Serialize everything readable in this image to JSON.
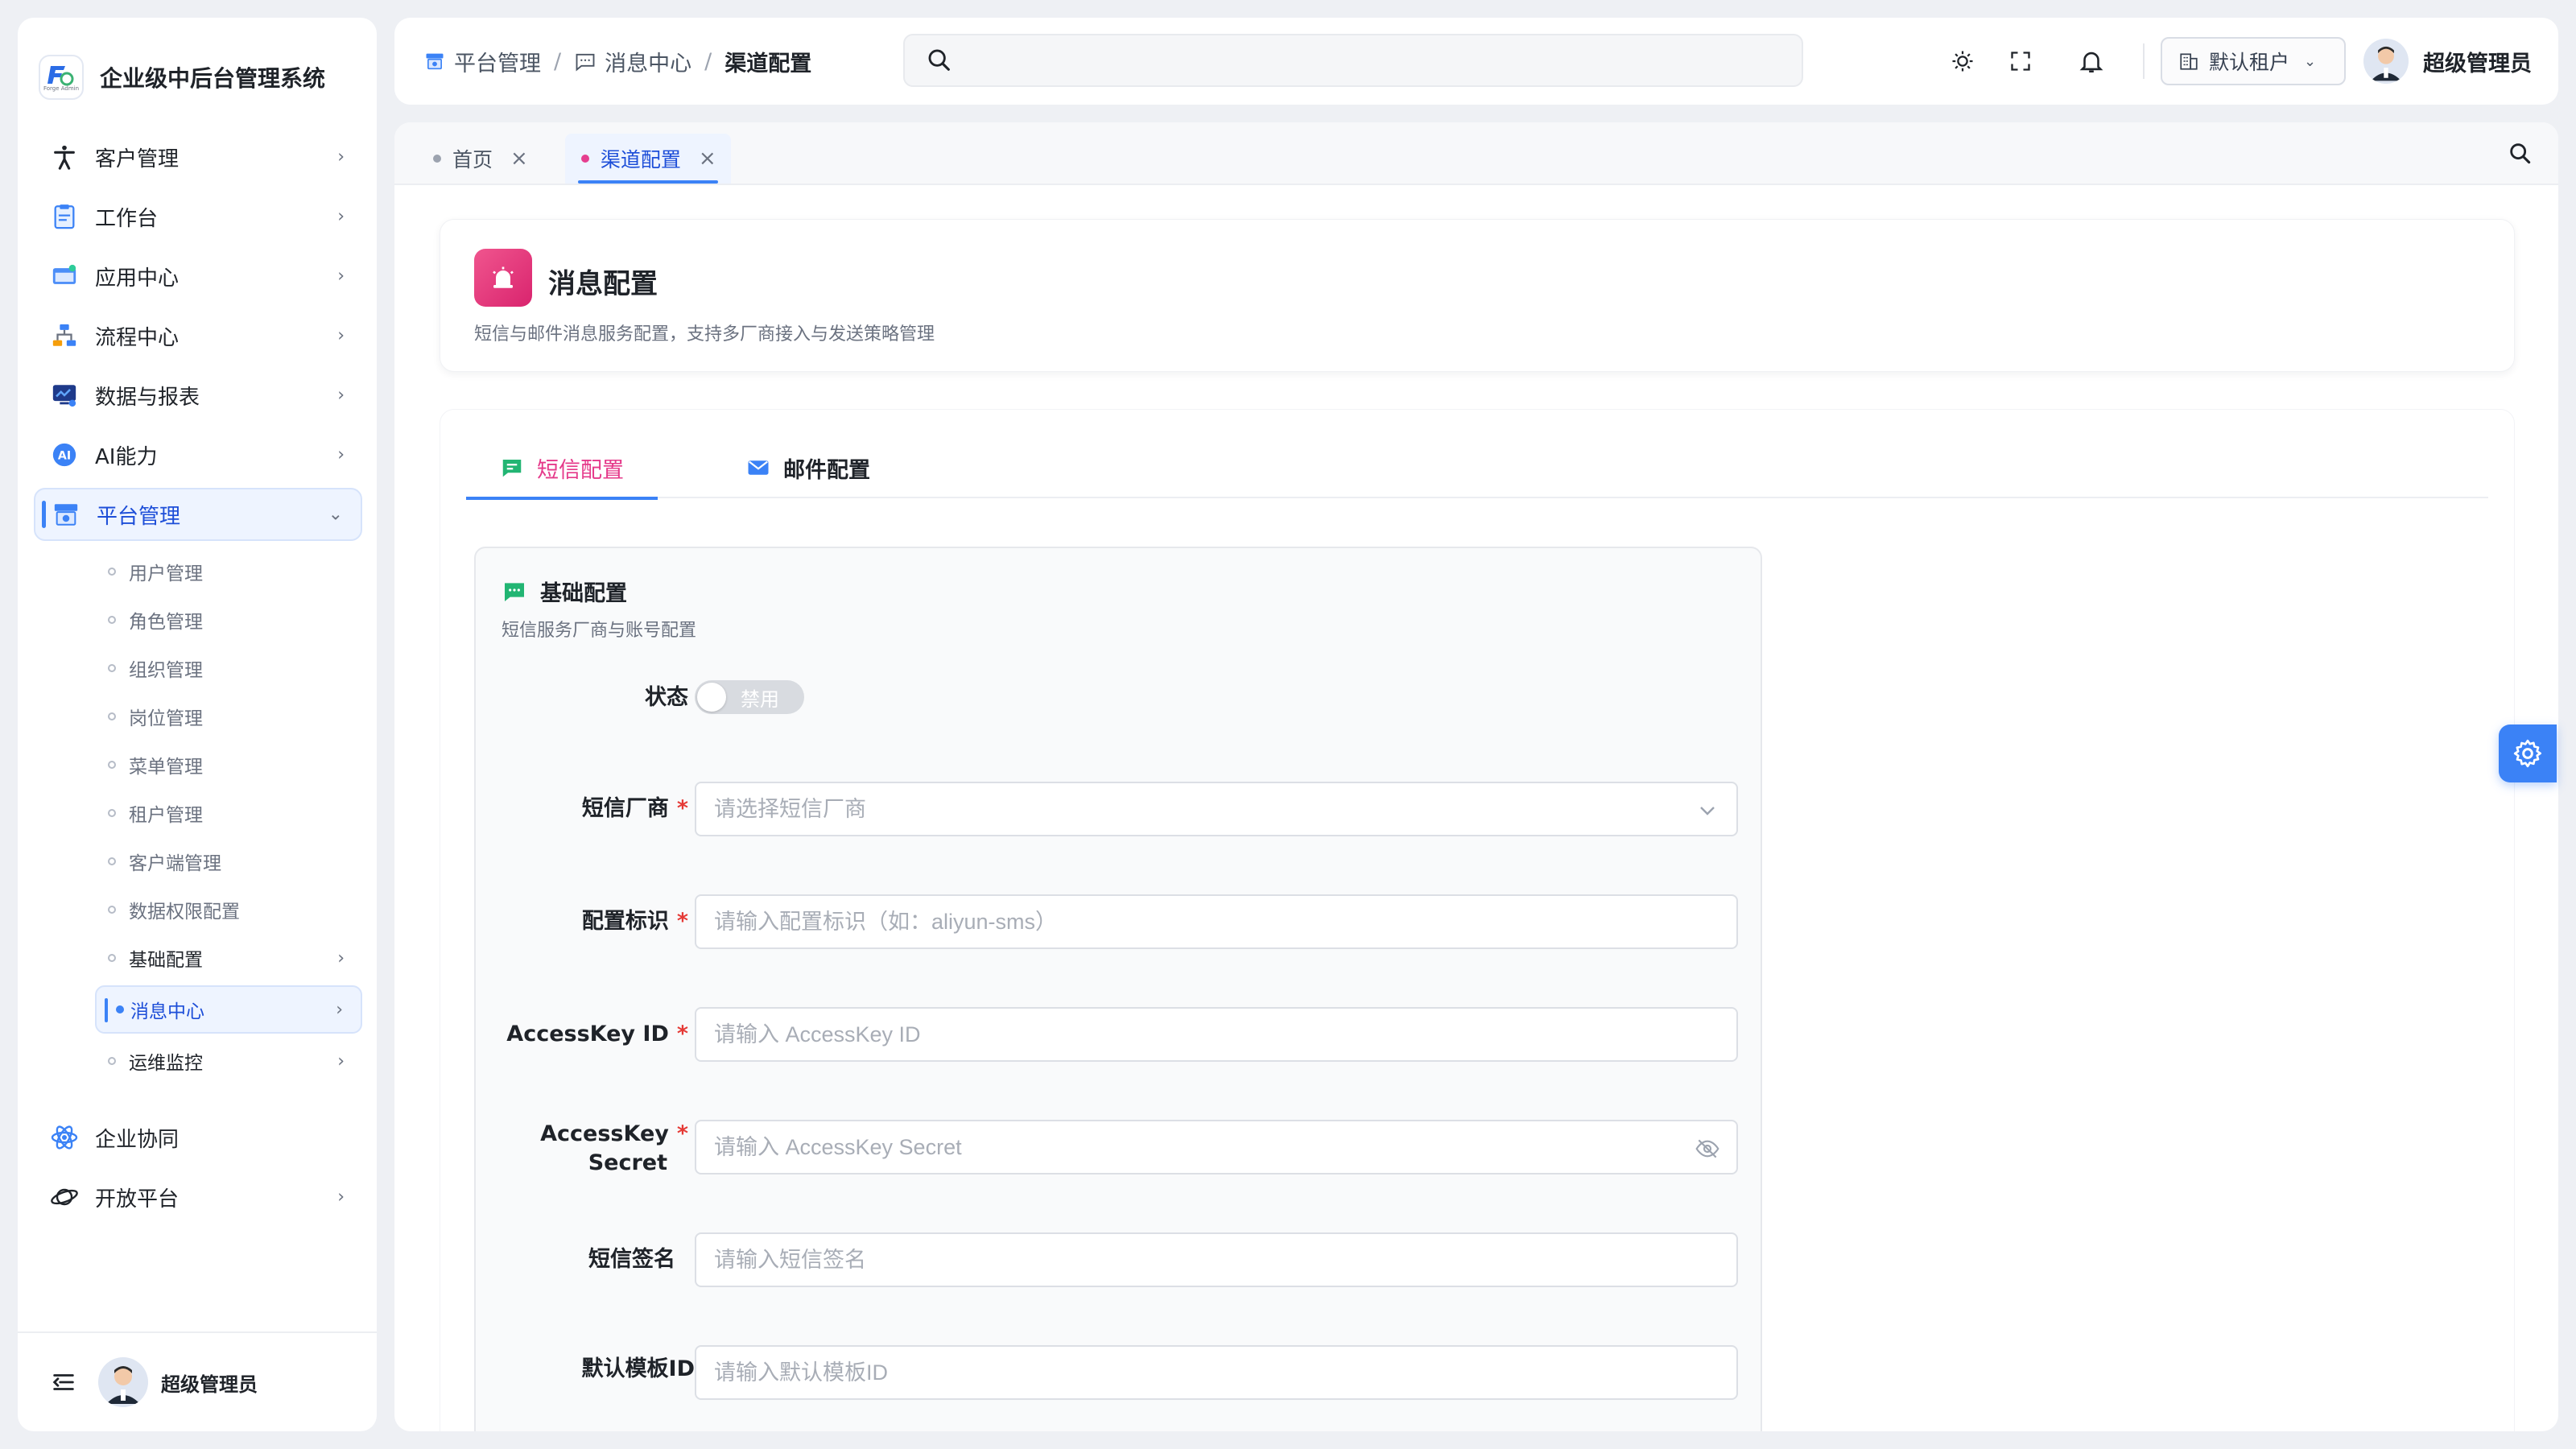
{
  "app": {
    "title": "企业级中后台管理系统",
    "logo_caption": "Forge Admin"
  },
  "sidebar": {
    "items": [
      {
        "label": "客户管理",
        "icon": "accessibility-icon"
      },
      {
        "label": "工作台",
        "icon": "clipboard-icon"
      },
      {
        "label": "应用中心",
        "icon": "app-window-icon"
      },
      {
        "label": "流程中心",
        "icon": "flow-icon"
      },
      {
        "label": "数据与报表",
        "icon": "monitor-chart-icon"
      },
      {
        "label": "AI能力",
        "icon": "ai-icon"
      },
      {
        "label": "平台管理",
        "icon": "platform-icon",
        "expanded": true
      }
    ],
    "platform_children": [
      {
        "label": "用户管理"
      },
      {
        "label": "角色管理"
      },
      {
        "label": "组织管理"
      },
      {
        "label": "岗位管理"
      },
      {
        "label": "菜单管理"
      },
      {
        "label": "租户管理"
      },
      {
        "label": "客户端管理"
      },
      {
        "label": "数据权限配置"
      },
      {
        "label": "基础配置"
      },
      {
        "label": "消息中心"
      },
      {
        "label": "运维监控"
      }
    ],
    "bottom_items": [
      {
        "label": "企业协同",
        "icon": "atom-icon"
      },
      {
        "label": "开放平台",
        "icon": "planet-icon"
      }
    ],
    "footer_user": "超级管理员"
  },
  "header": {
    "breadcrumb": [
      "平台管理",
      "消息中心",
      "渠道配置"
    ],
    "search_placeholder": "",
    "tenant": "默认租户",
    "user_name": "超级管理员"
  },
  "tabs": [
    {
      "label": "首页"
    },
    {
      "label": "渠道配置",
      "active": true
    }
  ],
  "page": {
    "title": "消息配置",
    "description": "短信与邮件消息服务配置，支持多厂商接入与发送策略管理"
  },
  "content_tabs": [
    {
      "label": "短信配置",
      "active": true
    },
    {
      "label": "邮件配置"
    }
  ],
  "form": {
    "section_title": "基础配置",
    "section_subtitle": "短信服务厂商与账号配置",
    "status_label": "状态",
    "status_value": "禁用",
    "vendor_label": "短信厂商",
    "vendor_placeholder": "请选择短信厂商",
    "config_key_label": "配置标识",
    "config_key_placeholder": "请输入配置标识（如：aliyun-sms）",
    "access_key_id_label": "AccessKey ID",
    "access_key_id_placeholder": "请输入 AccessKey ID",
    "access_key_secret_label_1": "AccessKey",
    "access_key_secret_label_2": "Secret",
    "access_key_secret_placeholder": "请输入 AccessKey Secret",
    "sign_label": "短信签名",
    "sign_placeholder": "请输入短信签名",
    "template_label": "默认模板ID",
    "template_placeholder": "请输入默认模板ID",
    "required_mark": "*"
  },
  "colors": {
    "accent": "#3b82f6",
    "brand_pink": "#e5398a",
    "required": "#e53935"
  }
}
